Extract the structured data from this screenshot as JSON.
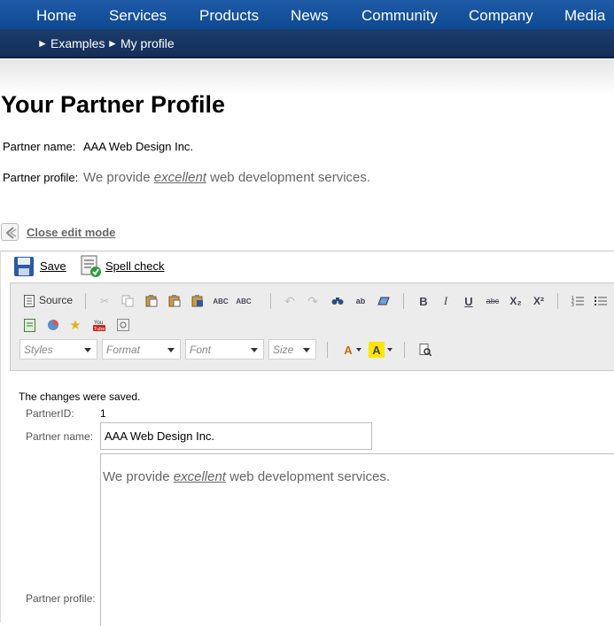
{
  "nav": {
    "items": [
      "Home",
      "Services",
      "Products",
      "News",
      "Community",
      "Company",
      "Media"
    ],
    "breadcrumb": [
      "Examples",
      "My profile"
    ],
    "crumb_marker": "►"
  },
  "page": {
    "title": "Your Partner Profile",
    "partner_name_label": "Partner name:",
    "partner_name_value": "AAA Web Design Inc.",
    "partner_profile_label": "Partner profile:",
    "profile_before": "We provide ",
    "profile_em": "excellent",
    "profile_after": " web development services.",
    "close_edit_mode": "Close edit mode"
  },
  "actions": {
    "save": "Save",
    "spell_check": "Spell check"
  },
  "editor": {
    "source_label": "Source",
    "bold": "B",
    "italic": "I",
    "underline": "U",
    "strike": "abc",
    "subscript": "X₂",
    "superscript": "X²",
    "dropdowns": [
      "Styles",
      "Format",
      "Font",
      "Size"
    ],
    "text_color_glyph": "A",
    "bg_color_glyph": "A",
    "spell_glyph": "ABC"
  },
  "form": {
    "saved_message": "The changes were saved.",
    "partner_id_label": "PartnerID:",
    "partner_id_value": "1",
    "partner_name_label": "Partner name:",
    "partner_name_input": "AAA Web Design Inc.",
    "partner_profile_label": "Partner profile:"
  }
}
